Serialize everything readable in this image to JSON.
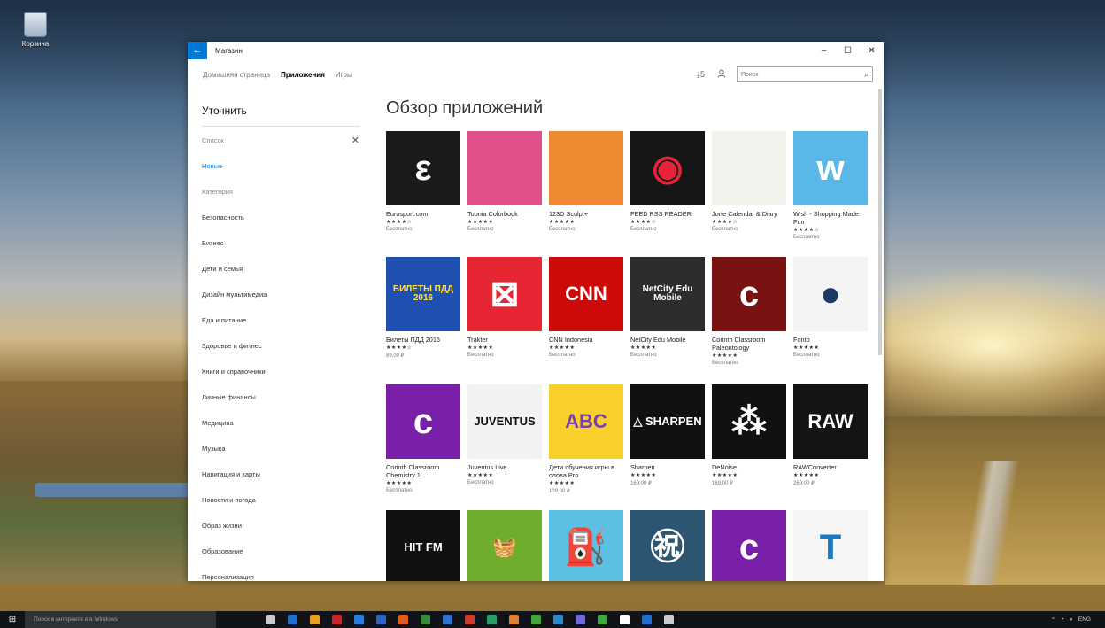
{
  "desktop": {
    "recycle_bin_label": "Корзина"
  },
  "window": {
    "title": "Магазин",
    "back_glyph": "←",
    "minimize_glyph": "–",
    "maximize_glyph": "☐",
    "close_glyph": "✕"
  },
  "nav": {
    "tabs": [
      {
        "label": "Домашняя страница"
      },
      {
        "label": "Приложения"
      },
      {
        "label": "Игры"
      }
    ],
    "downloads_label": "⤓5",
    "user_icon": "user-icon",
    "search_placeholder": "Поиск",
    "search_glyph": "⌕"
  },
  "sidebar": {
    "title": "Уточнить",
    "filter_label": "Список",
    "filter_clear": "✕",
    "selected": "Новые",
    "categories_header": "Категория",
    "categories": [
      "Безопасность",
      "Бизнес",
      "Дети и семья",
      "Дизайн мультимедиа",
      "Еда и питание",
      "Здоровье и фитнес",
      "Книги и справочники",
      "Личные финансы",
      "Медицина",
      "Музыка",
      "Навигация и карты",
      "Новости и погода",
      "Образ жизни",
      "Образование",
      "Персонализация"
    ]
  },
  "main": {
    "heading": "Обзор приложений",
    "apps": [
      {
        "name": "Eurosport.com",
        "stars": "★★★★☆",
        "price": "Бесплатно",
        "bg": "#1a1a1a",
        "img_text": "ε",
        "fg": "#ffffff"
      },
      {
        "name": "Toonia Colorbook",
        "stars": "★★★★★",
        "price": "Бесплатно",
        "bg": "#e2508c",
        "img_text": "",
        "fg": "#ffffff"
      },
      {
        "name": "123D Sculpt+",
        "stars": "★★★★★",
        "price": "Бесплатно",
        "bg": "#f08a32",
        "img_text": "",
        "fg": "#ffffff"
      },
      {
        "name": "FEED RSS READER",
        "stars": "★★★★☆",
        "price": "Бесплатно",
        "bg": "#161616",
        "img_text": "◉",
        "fg": "#e8233a"
      },
      {
        "name": "Jorte Calendar & Diary",
        "stars": "★★★★☆",
        "price": "Бесплатно",
        "bg": "#f3f1ec",
        "img_text": "",
        "fg": "#6b3b1b"
      },
      {
        "name": "Wish - Shopping Made Fun",
        "stars": "★★★★☆",
        "price": "Бесплатно",
        "bg": "#5ab8e8",
        "img_text": "w",
        "fg": "#ffffff"
      },
      {
        "name": "Билеты ПДД 2015",
        "stars": "★★★★☆",
        "price": "89,00 ₽",
        "bg": "#1f4fb0",
        "img_text": "БИЛЕТЫ ПДД 2016",
        "fg": "#ffe14a"
      },
      {
        "name": "Trakter",
        "stars": "★★★★★",
        "price": "Бесплатно",
        "bg": "#e62632",
        "img_text": "⊠",
        "fg": "#ffffff"
      },
      {
        "name": "CNN Indonesia",
        "stars": "★★★★★",
        "price": "Бесплатно",
        "bg": "#cc0a0a",
        "img_text": "CNN",
        "fg": "#ffffff"
      },
      {
        "name": "NetCity Edu Mobile",
        "stars": "★★★★★",
        "price": "Бесплатно",
        "bg": "#2d2d2d",
        "img_text": "NetCity Edu Mobile",
        "fg": "#ffffff"
      },
      {
        "name": "Corinth Classroom Paleontology",
        "stars": "★★★★★",
        "price": "Бесплатно",
        "bg": "#7a1212",
        "img_text": "c",
        "fg": "#ffffff"
      },
      {
        "name": "Fonto",
        "stars": "★★★★★",
        "price": "Бесплатно",
        "bg": "#f4f4f4",
        "img_text": "●",
        "fg": "#1b3a64"
      },
      {
        "name": "Corinth Classroom Chemistry 1",
        "stars": "★★★★★",
        "price": "Бесплатно",
        "bg": "#7a1fa8",
        "img_text": "c",
        "fg": "#ffffff"
      },
      {
        "name": "Juventus Live",
        "stars": "★★★★★",
        "price": "Бесплатно",
        "bg": "#f2f2f2",
        "img_text": "JUVENTUS",
        "fg": "#111111"
      },
      {
        "name": "Дети обучения игры в слова Pro",
        "stars": "★★★★★",
        "price": "109,00 ₽",
        "bg": "#f7d02c",
        "img_text": "ABC",
        "fg": "#7a3fb0"
      },
      {
        "name": "Sharpen",
        "stars": "★★★★★",
        "price": "169,00 ₽",
        "bg": "#111111",
        "img_text": "△ SHARPEN",
        "fg": "#ffffff"
      },
      {
        "name": "DeNoise",
        "stars": "★★★★★",
        "price": "169,00 ₽",
        "bg": "#111111",
        "img_text": "⁂",
        "fg": "#ffffff"
      },
      {
        "name": "RAWConverter",
        "stars": "★★★★★",
        "price": "269,00 ₽",
        "bg": "#141414",
        "img_text": "RAW",
        "fg": "#ffffff"
      },
      {
        "name": "",
        "stars": "",
        "price": "",
        "bg": "#111111",
        "img_text": "HIT FM",
        "fg": "#ffffff"
      },
      {
        "name": "",
        "stars": "",
        "price": "",
        "bg": "#6fae2d",
        "img_text": "🧺",
        "fg": "#ffffff"
      },
      {
        "name": "",
        "stars": "",
        "price": "",
        "bg": "#5bc0e3",
        "img_text": "⛽",
        "fg": "#e8512a"
      },
      {
        "name": "",
        "stars": "",
        "price": "",
        "bg": "#2c5571",
        "img_text": "㊗",
        "fg": "#ffffff"
      },
      {
        "name": "",
        "stars": "",
        "price": "",
        "bg": "#7a1fa8",
        "img_text": "c",
        "fg": "#ffffff"
      },
      {
        "name": "",
        "stars": "",
        "price": "",
        "bg": "#f5f5f5",
        "img_text": "T",
        "fg": "#1a78c2"
      }
    ]
  },
  "taskbar": {
    "start_glyph": "⊞",
    "search_placeholder": "Поиск в интернете и в Windows",
    "icon_colors": [
      "#cccccc",
      "#1f6fd0",
      "#e8a020",
      "#d0202a",
      "#2a7fd4",
      "#2b64c2",
      "#e25a1c",
      "#3b8a3a",
      "#3370c8",
      "#d03c2c",
      "#2b9b6a",
      "#e0802a",
      "#47a33c",
      "#2a8ad0",
      "#6c6cd6",
      "#3fa640",
      "#ffffff",
      "#1f6fd0",
      "#cccccc"
    ],
    "tray": {
      "lang": "ENG",
      "time": "",
      "date": ""
    }
  }
}
